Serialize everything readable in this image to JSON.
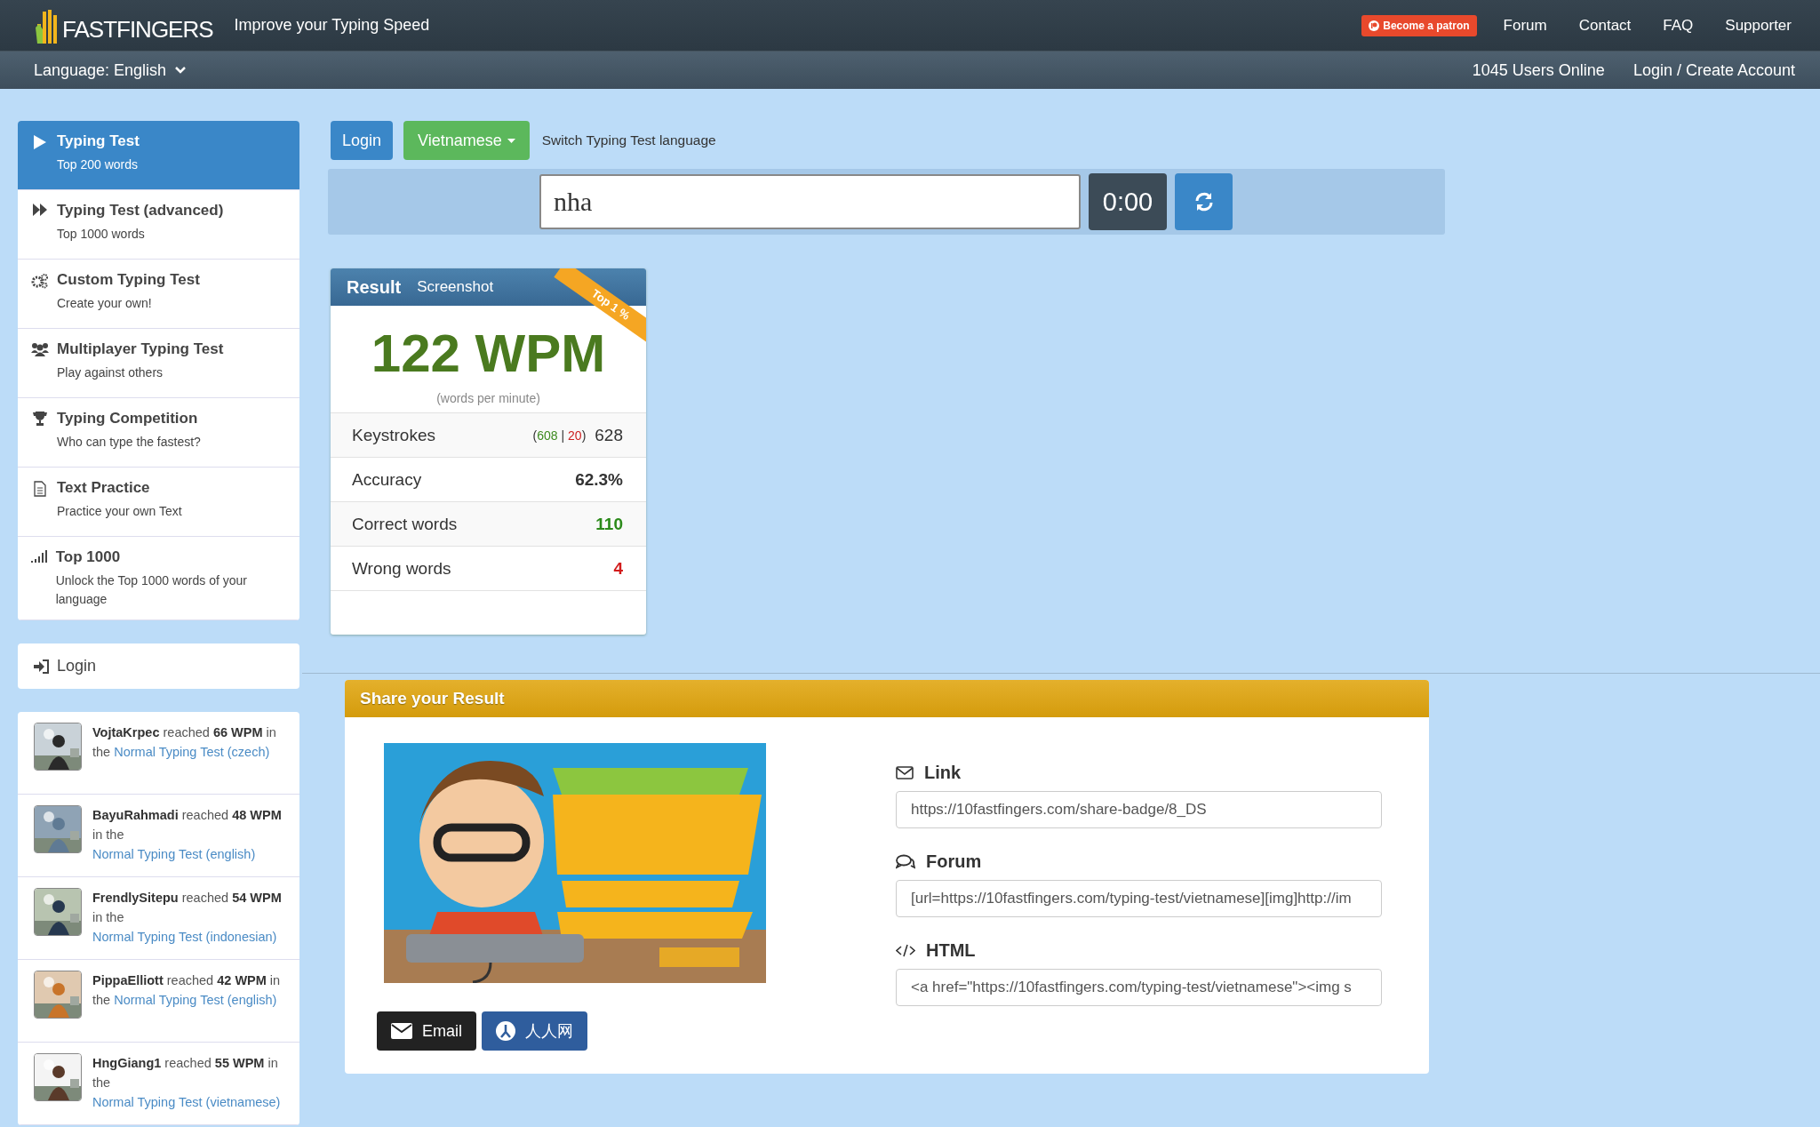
{
  "header": {
    "logo_text": "FASTFINGERS",
    "tagline": "Improve your Typing Speed",
    "patron_button": "Become a patron",
    "nav": [
      "Forum",
      "Contact",
      "FAQ",
      "Supporter"
    ],
    "language": "Language: English",
    "users_online": "1045 Users Online",
    "account_link": "Login / Create Account"
  },
  "sidebar": {
    "menu": [
      {
        "title": "Typing Test",
        "subtitle": "Top 200 words",
        "selected": true
      },
      {
        "title": "Typing Test (advanced)",
        "subtitle": "Top 1000 words",
        "selected": false
      },
      {
        "title": "Custom Typing Test",
        "subtitle": "Create your own!",
        "selected": false
      },
      {
        "title": "Multiplayer Typing Test",
        "subtitle": "Play against others",
        "selected": false
      },
      {
        "title": "Typing Competition",
        "subtitle": "Who can type the fastest?",
        "selected": false
      },
      {
        "title": "Text Practice",
        "subtitle": "Practice your own Text",
        "selected": false
      },
      {
        "title": "Top 1000",
        "subtitle": "Unlock the Top 1000 words of your language",
        "selected": false
      }
    ],
    "login": "Login",
    "activity": [
      {
        "text": "**VojtaKrpec** reached **66 WPM** in the",
        "link": "Normal Typing Test (czech)"
      },
      {
        "text": "**BayuRahmadi** reached **48 WPM** in the",
        "link": "Normal Typing Test (english)"
      },
      {
        "text": "**FrendlySitepu** reached **54 WPM** in the",
        "link": "Normal Typing Test (indonesian)"
      },
      {
        "text": "**PippaElliott** reached **42 WPM** in the",
        "link": "Normal Typing Test (english)"
      },
      {
        "text": "**HngGiang1** reached **55 WPM** in the",
        "link": "Normal Typing Test (vietnamese)"
      }
    ]
  },
  "toolbar": {
    "login_button": "Login",
    "language_button": "Vietnamese",
    "hint": "Switch Typing Test language"
  },
  "typing": {
    "value": "nha",
    "timer": "0:00"
  },
  "result": {
    "tabs": [
      {
        "label": "Result",
        "selected": true
      },
      {
        "label": "Screenshot",
        "selected": false
      }
    ],
    "ribbon": "Top 1 %",
    "wpm": "122 WPM",
    "wpm_caption": "(words per minute)",
    "rows": [
      {
        "kind": "keystrokes",
        "label": "Keystrokes",
        "open": "(",
        "correct": "608",
        "separator": "|",
        "wrong": "20",
        "close": ")",
        "value": "628"
      },
      {
        "kind": "plain",
        "label": "Accuracy",
        "value": "62.3%"
      },
      {
        "kind": "good",
        "label": "Correct words",
        "value": "110"
      },
      {
        "kind": "bad",
        "label": "Wrong words",
        "value": "4"
      }
    ]
  },
  "share": {
    "title": "Share your Result",
    "buttons": [
      {
        "kind": "email",
        "label": "Email"
      },
      {
        "kind": "renren",
        "label": "人人网"
      }
    ],
    "fields": [
      {
        "kind": "link",
        "label": "Link",
        "value": "https://10fastfingers.com/share-badge/8_DS"
      },
      {
        "kind": "forum",
        "label": "Forum",
        "value": "[url=https://10fastfingers.com/typing-test/vietnamese][img]http://im"
      },
      {
        "kind": "html",
        "label": "HTML",
        "value": "<a href=\"https://10fastfingers.com/typing-test/vietnamese\"><img s"
      }
    ]
  }
}
